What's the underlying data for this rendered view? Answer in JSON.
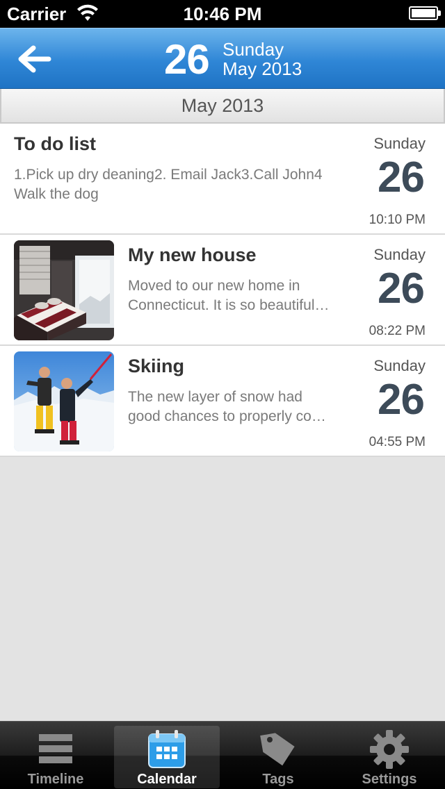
{
  "status_bar": {
    "carrier": "Carrier",
    "time": "10:46 PM"
  },
  "nav": {
    "day_number": "26",
    "weekday": "Sunday",
    "month_year": "May 2013",
    "accent_color": "#2f86d6"
  },
  "section_header": "May 2013",
  "entries": [
    {
      "title": "To do list",
      "body_line1": "1.Pick up dry deaning2. Email Jack3.Call John4",
      "body_line2": "Walk the dog",
      "weekday": "Sunday",
      "day": "26",
      "time": "10:10 PM"
    },
    {
      "title": "My new house",
      "body_line1": "Moved to our new home in",
      "body_line2": "Connecticut. It is so beautiful…",
      "weekday": "Sunday",
      "day": "26",
      "time": "08:22 PM",
      "thumbnail": "bedroom-photo"
    },
    {
      "title": "Skiing",
      "body_line1": "The new layer of snow had",
      "body_line2": "good chances to properly co…",
      "weekday": "Sunday",
      "day": "26",
      "time": "04:55 PM",
      "thumbnail": "skiers-photo"
    }
  ],
  "tabs": [
    {
      "label": "Timeline",
      "icon": "timeline-icon",
      "selected": false
    },
    {
      "label": "Calendar",
      "icon": "calendar-icon",
      "selected": true
    },
    {
      "label": "Tags",
      "icon": "tag-icon",
      "selected": false
    },
    {
      "label": "Settings",
      "icon": "gear-icon",
      "selected": false
    }
  ]
}
